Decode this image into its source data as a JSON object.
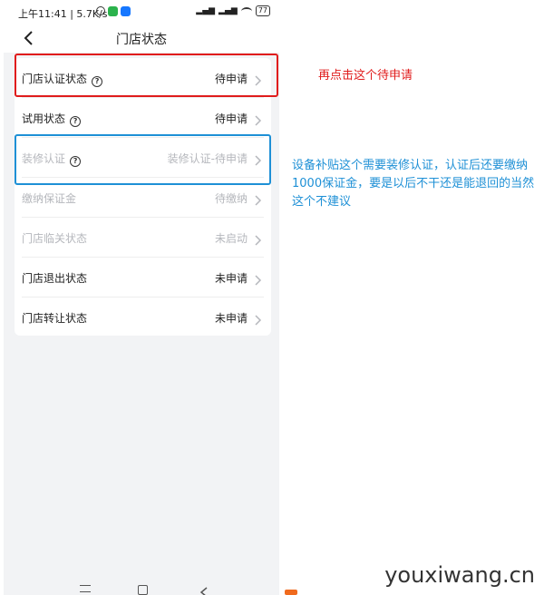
{
  "status_bar": {
    "time_speed": "上午11:41 | 5.7K/s",
    "battery": "77"
  },
  "header": {
    "title": "门店状态"
  },
  "rows": [
    {
      "label": "门店认证状态",
      "value": "待申请",
      "has_help": true,
      "disabled": false
    },
    {
      "label": "试用状态",
      "value": "待申请",
      "has_help": true,
      "disabled": false
    },
    {
      "label": "装修认证",
      "value": "装修认证-待申请",
      "has_help": true,
      "disabled": true
    },
    {
      "label": "缴纳保证金",
      "value": "待缴纳",
      "has_help": false,
      "disabled": true
    },
    {
      "label": "门店临关状态",
      "value": "未启动",
      "has_help": false,
      "disabled": true
    },
    {
      "label": "门店退出状态",
      "value": "未申请",
      "has_help": false,
      "disabled": false
    },
    {
      "label": "门店转让状态",
      "value": "未申请",
      "has_help": false,
      "disabled": false
    }
  ],
  "annotations": {
    "red_note": "再点击这个待申请",
    "blue_note": "设备补贴这个需要装修认证，认证后还要缴纳1000保证金，要是以后不干还是能退回的当然这个不建议"
  },
  "watermark": "youxiwang.cn",
  "colors": {
    "red": "#e01c1c",
    "blue": "#1e90d6",
    "disabled_text": "#b5b7bc"
  }
}
